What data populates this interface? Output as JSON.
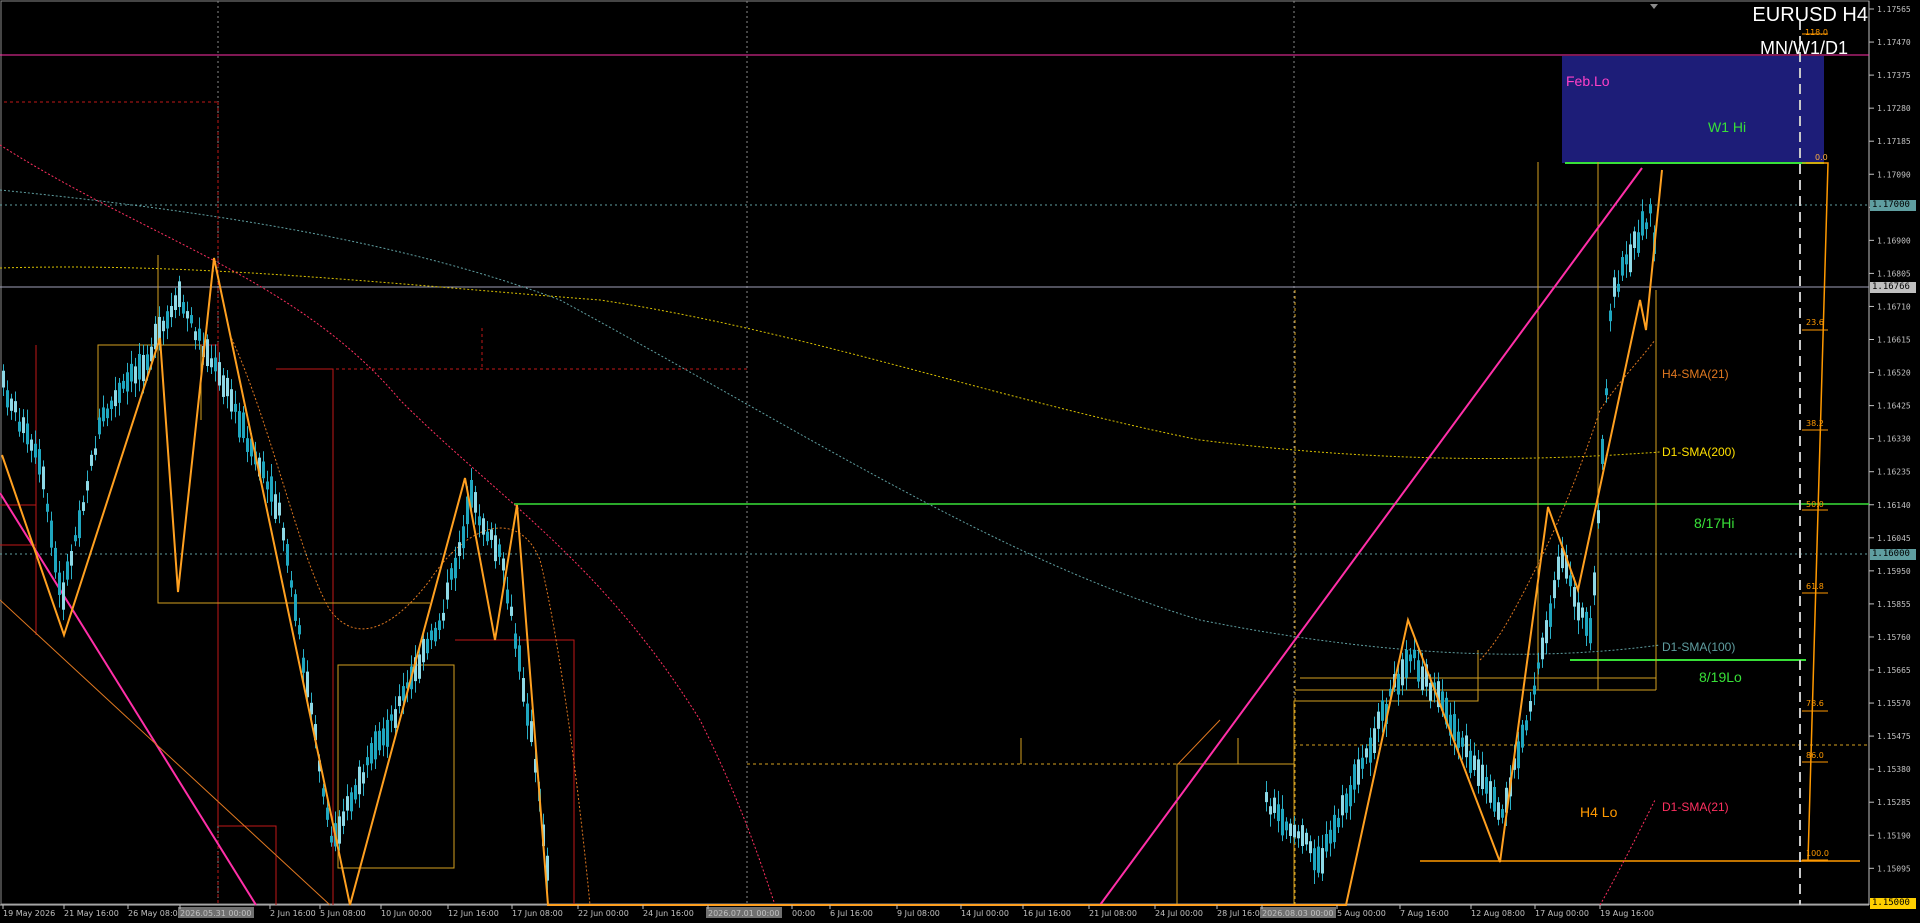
{
  "window": {
    "symbol_timeframe": "EURUSD H4",
    "subtitle": "MN/W1/D1"
  },
  "colors": {
    "background": "#000000",
    "candle_up": "#8fd9e6",
    "candle_down": "#1fa6bf",
    "zigzag": "#ffa020",
    "trendline": "#ff2fa8",
    "level_green": "#38e038",
    "zone_fill": "#1d1d78",
    "fib": "#ff9900",
    "h4_sma21": "#e07820",
    "d1_sma200": "#d8c000",
    "d1_sma100": "#5f9ea0",
    "d1_sma21": "#ff3060",
    "box_orange": "#d4a020",
    "box_red": "#c01818",
    "grid": "#8a8a8a",
    "price_axis": "#c0c0c0"
  },
  "price_axis": {
    "ticks": [
      "1.17565",
      "1.17470",
      "1.17375",
      "1.17280",
      "1.17185",
      "1.17090",
      "1.16995",
      "1.16900",
      "1.16805",
      "1.16710",
      "1.16615",
      "1.16520",
      "1.16425",
      "1.16330",
      "1.16235",
      "1.16140",
      "1.16045",
      "1.15950",
      "1.15855",
      "1.15760",
      "1.15665",
      "1.15570",
      "1.15475",
      "1.15380",
      "1.15285",
      "1.15190",
      "1.15095"
    ],
    "bid_label": "1.16766",
    "level_label_1": "1.17000",
    "level_label_2": "1.16000",
    "bottom_label": "1.15000"
  },
  "time_axis": {
    "labels": [
      "19 May 2026",
      "21 May 16:00",
      "26 May 08:00",
      "2026.05.31 00:00",
      "2 Jun 16:00",
      "5 Jun 08:00",
      "10 Jun 00:00",
      "12 Jun 16:00",
      "17 Jun 08:00",
      "22 Jun 00:00",
      "24 Jun 16:00",
      "2026.07.01 00:00",
      "00:00",
      "6 Jul 16:00",
      "9 Jul 08:00",
      "14 Jul 00:00",
      "16 Jul 16:00",
      "21 Jul 08:00",
      "24 Jul 00:00",
      "28 Jul 16:00",
      "2026.08.03 00:00",
      "5 Aug 00:00",
      "7 Aug 16:00",
      "12 Aug 08:00",
      "17 Aug 00:00",
      "19 Aug 16:00"
    ]
  },
  "fib_levels": [
    "118.0",
    "0.0",
    "23.6",
    "38.2",
    "50.0",
    "61.8",
    "78.6",
    "86.0",
    "100.0"
  ],
  "annotations": {
    "feb_lo": "Feb.Lo",
    "w1_hi": "W1 Hi",
    "h4_sma21": "H4-SMA(21)",
    "d1_sma200": "D1-SMA(200)",
    "hi_817": "8/17Hi",
    "d1_sma100": "D1-SMA(100)",
    "lo_819": "8/19Lo",
    "h4_lo": "H4 Lo",
    "d1_sma21": "D1-SMA(21)"
  }
}
